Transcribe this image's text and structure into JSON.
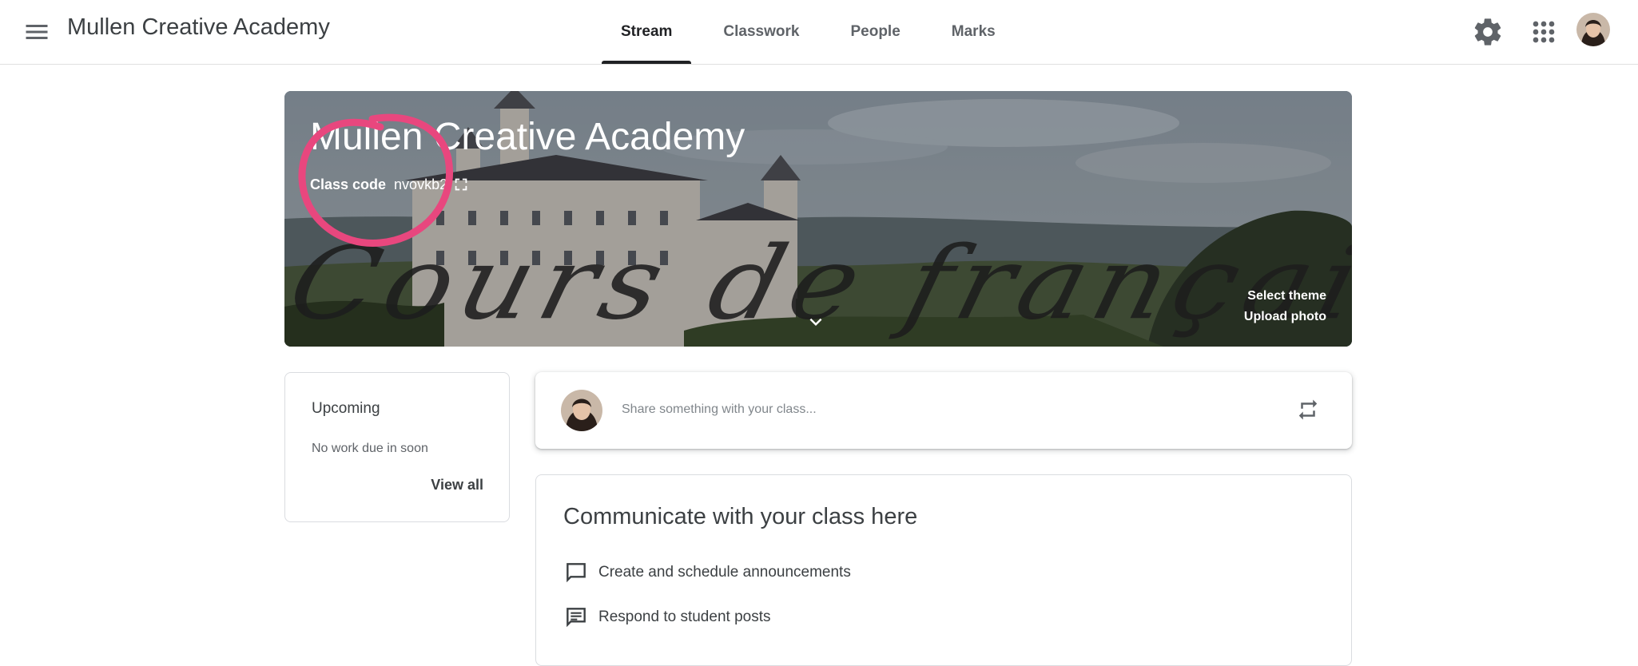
{
  "header": {
    "class_title": "Mullen Creative Academy",
    "tabs": [
      {
        "label": "Stream",
        "active": true
      },
      {
        "label": "Classwork",
        "active": false
      },
      {
        "label": "People",
        "active": false
      },
      {
        "label": "Marks",
        "active": false
      }
    ],
    "icons": [
      "hamburger-menu-icon",
      "settings-gear-icon",
      "apps-grid-icon",
      "account-avatar"
    ]
  },
  "banner": {
    "title": "Mullen Creative Academy",
    "class_code_label": "Class code",
    "class_code_value": "nvovkb2",
    "script_text": "Cours de français",
    "select_theme": "Select theme",
    "upload_photo": "Upload photo",
    "annotation_color": "#e8477e"
  },
  "upcoming": {
    "heading": "Upcoming",
    "empty_text": "No work due in soon",
    "view_all": "View all"
  },
  "share": {
    "placeholder": "Share something with your class..."
  },
  "communicate": {
    "heading": "Communicate with your class here",
    "items": [
      {
        "icon": "announcement-icon",
        "label": "Create and schedule announcements"
      },
      {
        "icon": "comment-icon",
        "label": "Respond to student posts"
      }
    ]
  }
}
